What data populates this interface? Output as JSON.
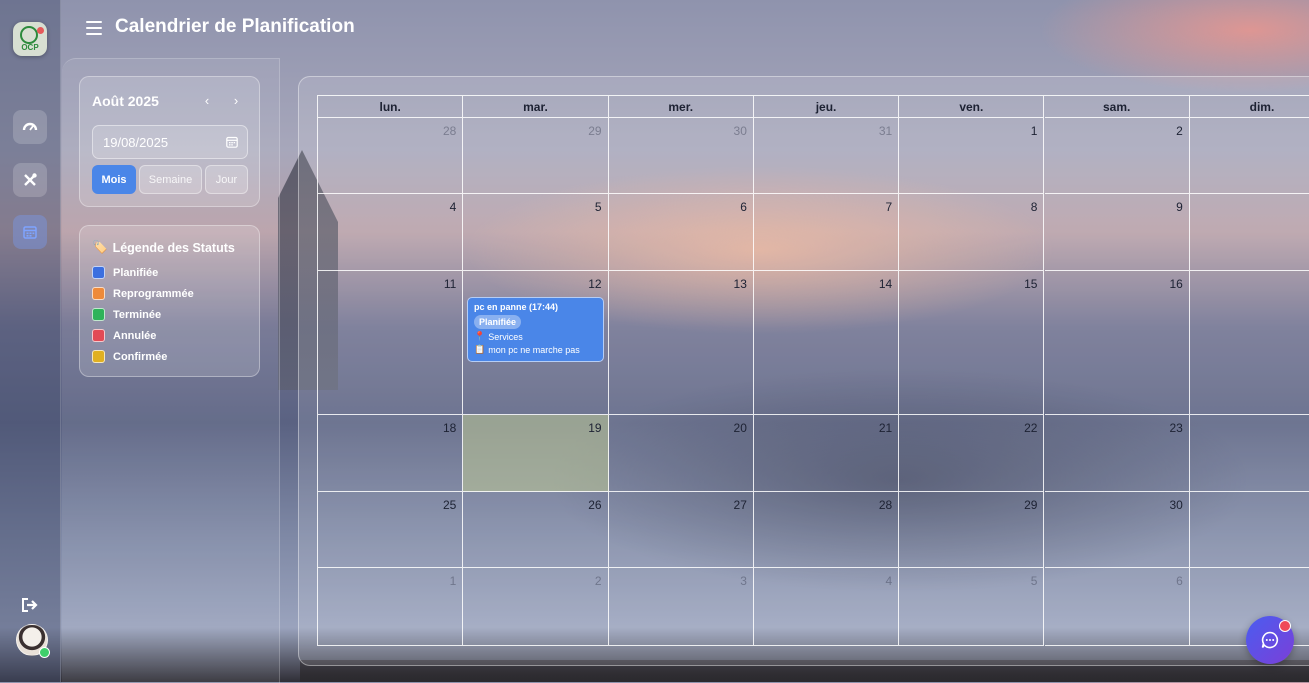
{
  "header": {
    "title": "Calendrier de Planification"
  },
  "logo": {
    "text": "OCP"
  },
  "sidebar": {
    "month_label": "Août 2025",
    "prev": "‹",
    "next": "›",
    "date_value": "19/08/2025",
    "views": [
      "Mois",
      "Semaine",
      "Jour"
    ],
    "active_view": "Mois"
  },
  "legend": {
    "icon": "🏷️",
    "title": "Légende des Statuts",
    "items": [
      {
        "label": "Planifiée",
        "color": "#3b6fe0"
      },
      {
        "label": "Reprogrammée",
        "color": "#ee8a3a"
      },
      {
        "label": "Terminée",
        "color": "#2fb35a"
      },
      {
        "label": "Annulée",
        "color": "#e24a55"
      },
      {
        "label": "Confirmée",
        "color": "#e0b021"
      }
    ]
  },
  "calendar": {
    "weekdays": [
      "lun.",
      "mar.",
      "mer.",
      "jeu.",
      "ven.",
      "sam.",
      "dim."
    ],
    "weeks": [
      [
        "28",
        "29",
        "30",
        "31",
        "1",
        "2",
        ""
      ],
      [
        "4",
        "5",
        "6",
        "7",
        "8",
        "9",
        ""
      ],
      [
        "11",
        "12",
        "13",
        "14",
        "15",
        "16",
        ""
      ],
      [
        "18",
        "19",
        "20",
        "21",
        "22",
        "23",
        ""
      ],
      [
        "25",
        "26",
        "27",
        "28",
        "29",
        "30",
        ""
      ],
      [
        "1",
        "2",
        "3",
        "4",
        "5",
        "6",
        ""
      ]
    ],
    "event": {
      "title": "pc en panne (17:44)",
      "status": "Planifiée",
      "location_icon": "📍",
      "location": "Services",
      "note_icon": "📋",
      "note": "mon pc ne marche pas"
    }
  }
}
